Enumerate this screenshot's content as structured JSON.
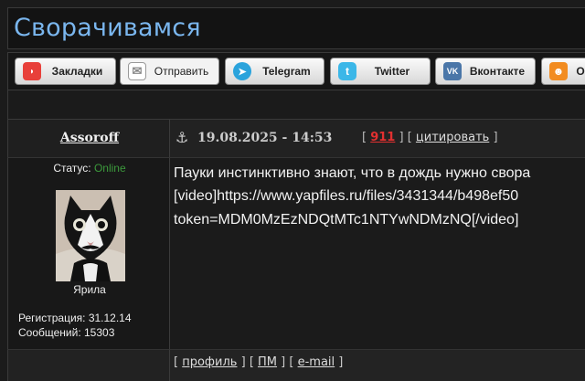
{
  "topic": {
    "title": "Сворачивамся"
  },
  "share": {
    "buttons": [
      {
        "label": "Закладки",
        "icon": "bookmark-icon"
      },
      {
        "label": "Отправить",
        "icon": "mail-icon"
      },
      {
        "label": "Telegram",
        "icon": "telegram-icon"
      },
      {
        "label": "Twitter",
        "icon": "twitter-icon"
      },
      {
        "label": "Вконтакте",
        "icon": "vk-icon"
      },
      {
        "label": "О",
        "icon": "odnoklassniki-icon"
      }
    ]
  },
  "post": {
    "author": "Assoroff",
    "date": "19.08.2025 - 14:53",
    "open_bracket": "[",
    "number": "911",
    "mid_bracket": "] [",
    "quote_label": "цитировать",
    "close_bracket": "]",
    "body": {
      "line1": "Пауки инстинктивно знают, что в дождь нужно свора",
      "line2": "[video]https://www.yapfiles.ru/files/3431344/b498ef50",
      "line3": "token=MDM0MzEzNDQtMTc1NTYwNDMzNQ[/video]"
    }
  },
  "user": {
    "status_label": "Статус:",
    "status_value": "Online",
    "avatar_name": "Ярила",
    "registration": "Регистрация: 31.12.14",
    "messages": "Сообщений: 15303"
  },
  "footer": {
    "b1": "[",
    "profile": "профиль",
    "b2": "] [",
    "pm": "ПМ",
    "b3": "] [",
    "email": "e-mail",
    "b4": "]"
  },
  "colors": {
    "title": "#7ab6ee",
    "online": "#3c9a3c",
    "post_number": "#e23030"
  }
}
